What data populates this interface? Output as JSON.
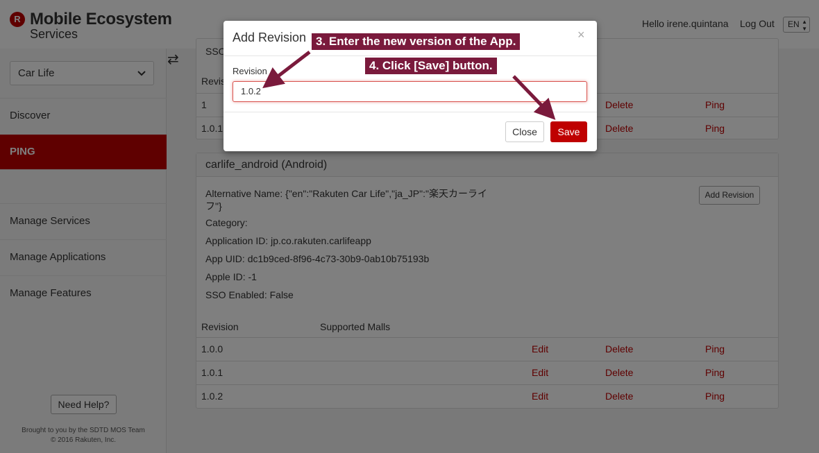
{
  "header": {
    "logo_mark": "R",
    "title": "Mobile Ecosystem",
    "subtitle": "Services",
    "greeting": "Hello irene.quintana",
    "logout": "Log Out",
    "language": "EN"
  },
  "sidebar": {
    "service_select": "Car Life",
    "items": [
      {
        "label": "Discover"
      },
      {
        "label": "PING"
      },
      {
        "label": "Manage Services"
      },
      {
        "label": "Manage Applications"
      },
      {
        "label": "Manage Features"
      }
    ],
    "help": "Need Help?",
    "footer_line1": "Brought to you by the SDTD MOS Team",
    "footer_line2": "© 2016 Rakuten, Inc."
  },
  "panel_top": {
    "partial_text": "SSO",
    "rev_header_partial": "Revisi",
    "rows": [
      {
        "revision": "1",
        "delete": "Delete",
        "ping": "Ping"
      },
      {
        "revision": "1.0.1",
        "delete": "Delete",
        "ping": "Ping"
      }
    ]
  },
  "panel_android": {
    "title": "carlife_android (Android)",
    "alt_name_line1": "Alternative Name: {\"en\":\"Rakuten Car Life\",\"ja_JP\":\"楽天カーライ",
    "alt_name_line2": "フ\"}",
    "category": "Category:",
    "app_id": "Application ID: jp.co.rakuten.carlifeapp",
    "app_uid": "App UID: dc1b9ced-8f96-4c73-30b9-0ab10b75193b",
    "apple_id": "Apple ID: -1",
    "sso": "SSO Enabled: False",
    "add_revision": "Add Revision",
    "col_revision": "Revision",
    "col_malls": "Supported Malls",
    "rows": [
      {
        "revision": "1.0.0",
        "edit": "Edit",
        "delete": "Delete",
        "ping": "Ping"
      },
      {
        "revision": "1.0.1",
        "edit": "Edit",
        "delete": "Delete",
        "ping": "Ping"
      },
      {
        "revision": "1.0.2",
        "edit": "Edit",
        "delete": "Delete",
        "ping": "Ping"
      }
    ]
  },
  "modal": {
    "title": "Add Revision",
    "close_x": "×",
    "label": "Revision",
    "input_value": "1.0.2",
    "close_button": "Close",
    "save_button": "Save"
  },
  "callouts": {
    "step3": "3. Enter the new version of the App.",
    "step4": "4. Click [Save] button."
  },
  "colors": {
    "brand": "#bf0000",
    "callout": "#7a1a3c"
  }
}
